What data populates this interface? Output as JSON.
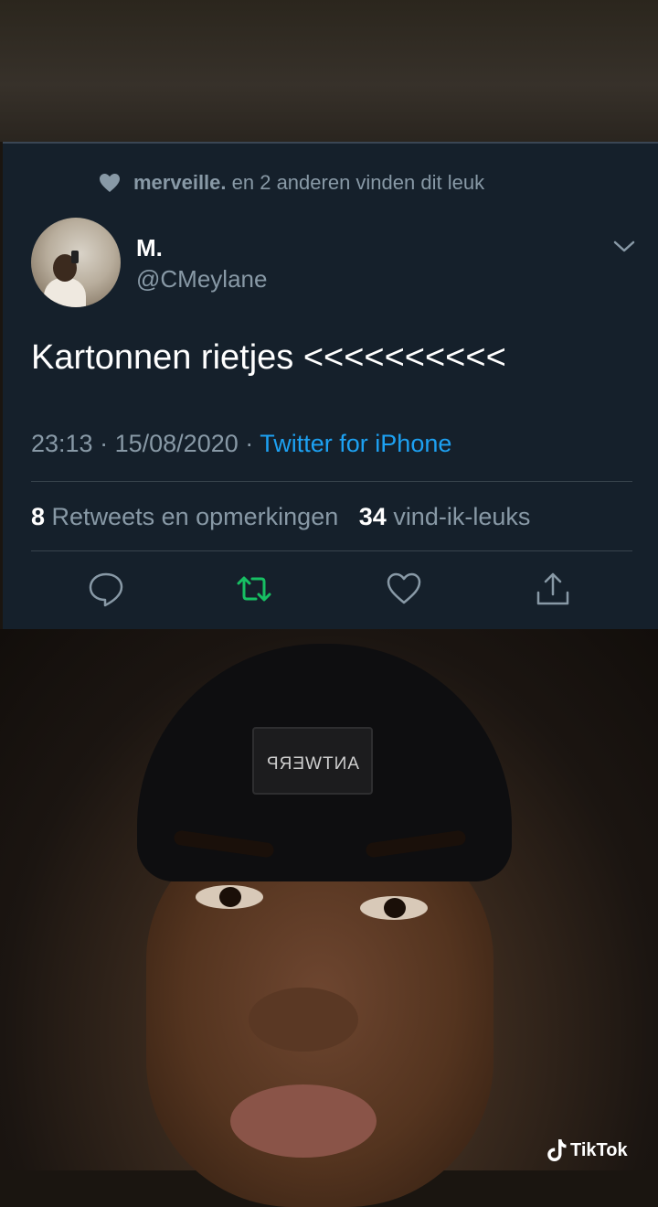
{
  "like_note": {
    "name": "merveille.",
    "text": "en 2 anderen vinden dit leuk"
  },
  "author": {
    "name": "M.",
    "handle": "@CMeylane"
  },
  "tweet": {
    "text": "Kartonnen rietjes <<<<<<<<<<"
  },
  "meta": {
    "time": "23:13",
    "date": "15/08/2020",
    "separator": "·",
    "source": "Twitter for iPhone"
  },
  "stats": {
    "retweets_count": "8",
    "retweets_label": "Retweets en opmerkingen",
    "likes_count": "34",
    "likes_label": "vind-ik-leuks"
  },
  "icons": {
    "reply": "reply-icon",
    "retweet": "retweet-icon",
    "like": "heart-icon",
    "share": "share-icon",
    "menu": "chevron-down-icon"
  },
  "colors": {
    "card_bg": "#15202b",
    "muted": "#8899a6",
    "link": "#1da1f2",
    "retweet_active": "#17bf63"
  },
  "photo_text": {
    "beanie_label": "ANTWERP"
  },
  "watermark": {
    "brand": "TikTok"
  }
}
